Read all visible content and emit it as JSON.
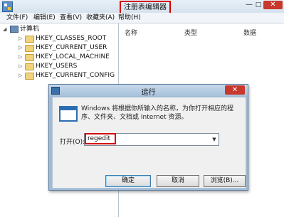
{
  "regedit": {
    "title": "注册表编辑器",
    "window_controls": {
      "minimize": "—",
      "maximize": "□",
      "close": "✕"
    },
    "menu": [
      "文件(F)",
      "编辑(E)",
      "查看(V)",
      "收藏夹(A)",
      "帮助(H)"
    ],
    "tree": {
      "root": "计算机",
      "items": [
        "HKEY_CLASSES_ROOT",
        "HKEY_CURRENT_USER",
        "HKEY_LOCAL_MACHINE",
        "HKEY_USERS",
        "HKEY_CURRENT_CONFIG"
      ]
    },
    "list_headers": [
      "名称",
      "类型",
      "数据"
    ]
  },
  "run_dialog": {
    "title": "运行",
    "close": "✕",
    "description": "Windows 将根据你所输入的名称，为你打开相应的程序、文件夹、文档或 Internet 资源。",
    "open_label": "打开(O):",
    "open_value": "regedit",
    "buttons": {
      "ok": "确定",
      "cancel": "取消",
      "browse": "浏览(B)..."
    }
  },
  "colors": {
    "highlight_box": "#d40000",
    "close_button": "#c8382c"
  },
  "icons": [
    "registry-editor-icon",
    "computer-icon",
    "folder-icon",
    "run-icon",
    "dropdown-arrow-icon"
  ]
}
